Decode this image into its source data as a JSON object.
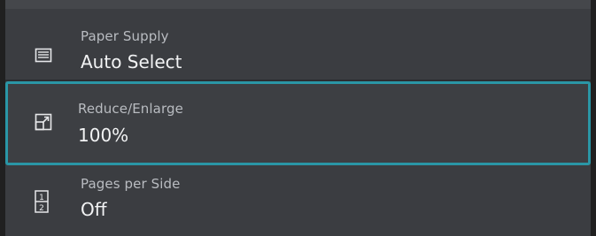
{
  "colors": {
    "background": "#202020",
    "panel": "#3b3d41",
    "selection_border": "#2a96a6",
    "title_text": "#b9bcc1",
    "value_text": "#f2f3f4"
  },
  "settings": [
    {
      "title": "Paper Supply",
      "value": "Auto Select",
      "icon": "paper-tray-icon",
      "selected": false
    },
    {
      "title": "Reduce/Enlarge",
      "value": "100%",
      "icon": "resize-icon",
      "selected": true
    },
    {
      "title": "Pages per Side",
      "value": "Off",
      "icon": "pages-per-side-icon",
      "selected": false,
      "icon_digits": [
        "1",
        "2"
      ]
    }
  ]
}
